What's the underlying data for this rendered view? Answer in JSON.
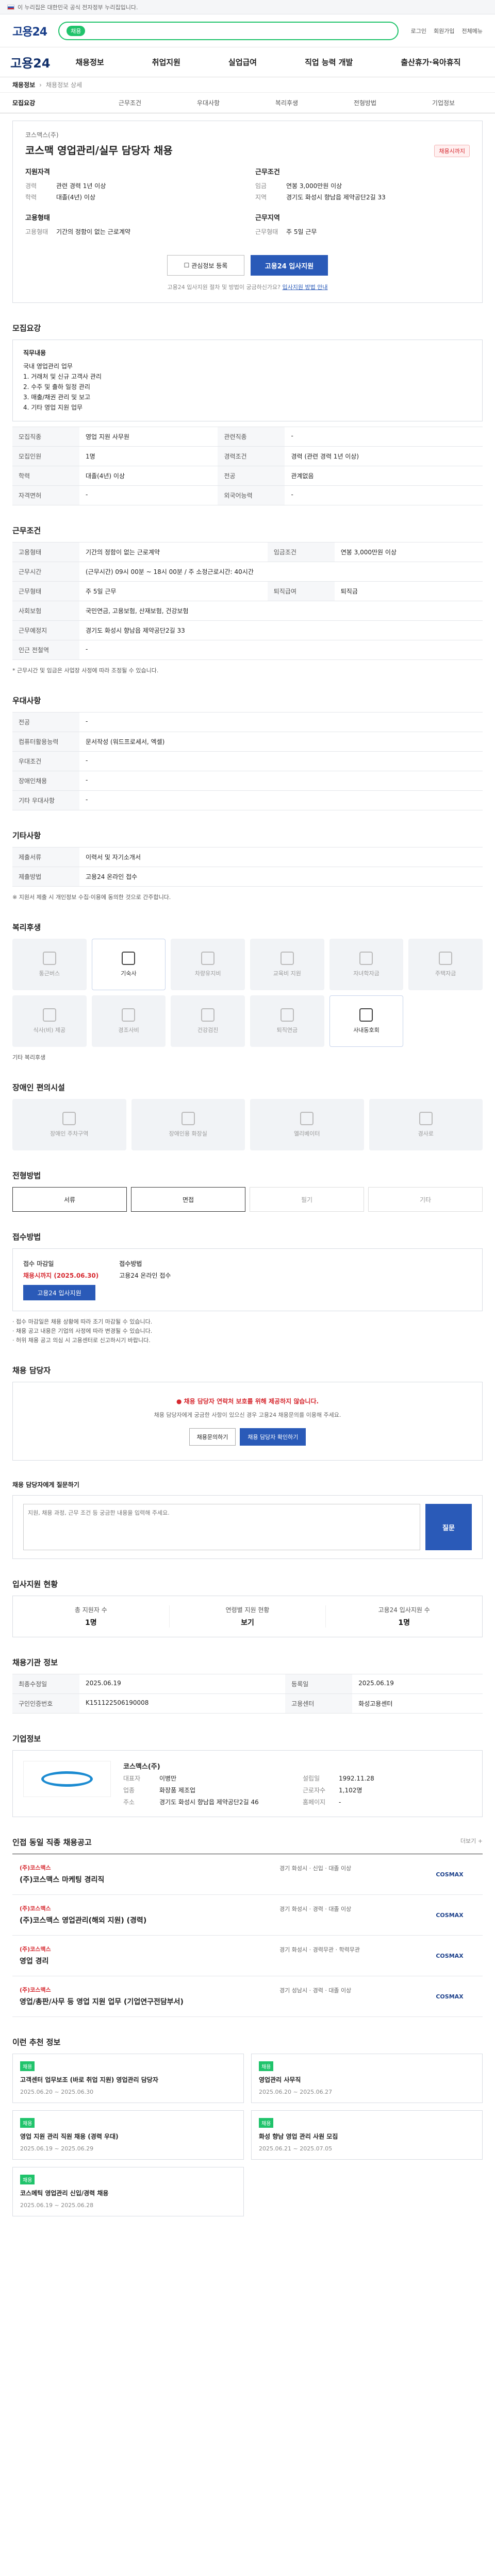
{
  "gov_notice": "이 누리집은 대한민국 공식 전자정부 누리집입니다.",
  "site": {
    "brand": "고용24",
    "search_tag": "채용",
    "header_links": [
      "로그인",
      "회원가입",
      "전체메뉴"
    ],
    "gnb": [
      "채용정보",
      "취업지원",
      "실업급여",
      "직업 능력 개발",
      "출산휴가·육아휴직"
    ]
  },
  "breadcrumb": {
    "current": "채용정보",
    "path": "채용정보 상세"
  },
  "tabs": [
    "모집요강",
    "근무조건",
    "우대사항",
    "복리후생",
    "전형방법",
    "기업정보"
  ],
  "job": {
    "company": "코스맥스(주)",
    "title": "코스맥 영업관리/실무 담당자 채용",
    "deadline_badge": "채용시까지",
    "summary_headings": {
      "recruit": "지원자격",
      "work": "근무조건",
      "cond": "고용형태",
      "place": "근무지역"
    },
    "summary": [
      {
        "k": "경력",
        "v": "관련 경력 1년 이상"
      },
      {
        "k": "학력",
        "v": "대졸(4년) 이상"
      },
      {
        "k": "임금",
        "v": "연봉 3,000만원 이상"
      },
      {
        "k": "지역",
        "v": "경기도 화성시 향남읍 제약공단2길 33"
      },
      {
        "k": "고용형태",
        "v": "기간의 정함이 없는 근로계약"
      },
      {
        "k": "근무형태",
        "v": "주 5일 근무"
      }
    ],
    "scrap_label": "관심정보 등록",
    "apply_label": "고용24 입사지원",
    "notice": "고용24 입사지원 절차 및 방법이 궁금하신가요?",
    "notice_link": "입사지원 방법 안내"
  },
  "recruit": {
    "heading": "모집요강",
    "duty_title": "직무내용",
    "duty_lines": [
      "국내 영업관리 업무",
      "1. 거래처 및 신규 고객사 관리",
      "2. 수주 및 출하 일정 관리",
      "3. 매출/채권 관리 및 보고",
      "4. 기타 영업 지원 업무"
    ],
    "rows": [
      {
        "k": "모집직종",
        "v": "영업 지원 사무원"
      },
      {
        "k": "관련직종",
        "v": "-"
      },
      {
        "k": "모집인원",
        "v": "1명"
      },
      {
        "k": "경력조건",
        "v": "경력 (관련 경력 1년 이상)"
      },
      {
        "k": "학력",
        "v": "대졸(4년) 이상"
      },
      {
        "k": "전공",
        "v": "관계없음"
      },
      {
        "k": "자격면허",
        "v": "-"
      },
      {
        "k": "외국어능력",
        "v": "-"
      }
    ]
  },
  "work": {
    "heading": "근무조건",
    "rows": [
      {
        "k": "고용형태",
        "v": "기간의 정함이 없는 근로계약"
      },
      {
        "k": "임금조건",
        "v": "연봉 3,000만원 이상"
      },
      {
        "k": "근무시간",
        "v": "(근무시간) 09시 00분 ~ 18시 00분 / 주 소정근로시간: 40시간"
      },
      {
        "k": "근무형태",
        "v": "주 5일 근무"
      },
      {
        "k": "사회보험",
        "v": "국민연금, 고용보험, 산재보험, 건강보험"
      },
      {
        "k": "퇴직급여",
        "v": "퇴직금"
      },
      {
        "k": "근무예정지",
        "v": "경기도 화성시 향남읍 제약공단2길 33"
      },
      {
        "k": "인근 전철역",
        "v": "-"
      }
    ],
    "foot": "* 근무시간 및 임금은 사업장 사정에 따라 조정될 수 있습니다."
  },
  "preference": {
    "heading": "우대사항",
    "rows": [
      {
        "k": "전공",
        "v": "-"
      },
      {
        "k": "컴퓨터활용능력",
        "v": "문서작성 (워드프로세서, 엑셀)"
      },
      {
        "k": "우대조건",
        "v": "-"
      },
      {
        "k": "장애인채용",
        "v": "-"
      },
      {
        "k": "기타 우대사항",
        "v": "-"
      }
    ]
  },
  "extra": {
    "heading": "기타사항",
    "rows": [
      {
        "k": "제출서류",
        "v": "이력서 및 자기소개서"
      },
      {
        "k": "제출방법",
        "v": "고용24 온라인 접수"
      }
    ],
    "note": "※ 지원서 제출 시 개인정보 수집·이용에 동의한 것으로 간주합니다."
  },
  "welfare": {
    "heading": "복리후생",
    "items": [
      {
        "label": "통근버스",
        "on": false
      },
      {
        "label": "기숙사",
        "on": true
      },
      {
        "label": "차량유지비",
        "on": false
      },
      {
        "label": "교육비 지원",
        "on": false
      },
      {
        "label": "자녀학자금",
        "on": false
      },
      {
        "label": "주택자금",
        "on": false
      },
      {
        "label": "식사(비) 제공",
        "on": false
      },
      {
        "label": "경조사비",
        "on": false
      },
      {
        "label": "건강검진",
        "on": false
      },
      {
        "label": "퇴직연금",
        "on": false
      },
      {
        "label": "사내동호회",
        "on": true
      }
    ],
    "other_label": "기타 복리후생"
  },
  "disabled": {
    "heading": "장애인 편의시설",
    "items": [
      "장애인 주차구역",
      "장애인용 화장실",
      "엘리베이터",
      "경사로"
    ]
  },
  "process": {
    "heading": "전형방법",
    "steps": [
      {
        "label": "서류",
        "on": true
      },
      {
        "label": "면접",
        "on": true
      },
      {
        "label": "필기",
        "on": false
      },
      {
        "label": "기타",
        "on": false
      }
    ]
  },
  "howto": {
    "heading": "접수방법",
    "deadline_title": "접수 마감일",
    "deadline": "채용시까지 (2025.06.30)",
    "method_title": "접수방법",
    "method": "고용24 온라인 접수",
    "apply_label": "고용24 입사지원",
    "bullets": [
      "· 접수 마감일은 채용 상황에 따라 조기 마감될 수 있습니다.",
      "· 채용 공고 내용은 기업의 사정에 따라 변경될 수 있습니다.",
      "· 허위 채용 공고 의심 시 고용센터로 신고하시기 바랍니다."
    ]
  },
  "contact": {
    "heading": "채용 담당자",
    "warn": "채용 담당자 연락처 보호를 위해 제공하지 않습니다.",
    "desc": "채용 담당자에게 궁금한 사항이 있으신 경우 고용24 채용문의를 이용해 주세요.",
    "btn1": "채용문의하기",
    "btn2": "채용 담당자 확인하기"
  },
  "inquiry": {
    "heading": "채용 담당자에게 질문하기",
    "placeholder": "지원, 채용 과정, 근무 조건 등 궁금한 내용을 입력해 주세요.",
    "send": "질문"
  },
  "stats": {
    "heading": "입사지원 현황",
    "items": [
      {
        "label": "총 지원자 수",
        "value": "1명"
      },
      {
        "label": "연령별 지원 현황",
        "value": "보기"
      },
      {
        "label": "고용24 입사지원 수",
        "value": "1명"
      }
    ]
  },
  "regi": {
    "heading": "채용기관 정보",
    "rows": [
      {
        "k": "최종수정일",
        "v": "2025.06.19"
      },
      {
        "k": "등록일",
        "v": "2025.06.19"
      },
      {
        "k": "구인인증번호",
        "v": "K151122506190008"
      },
      {
        "k": "고용센터",
        "v": "화성고용센터"
      }
    ]
  },
  "company": {
    "heading": "기업정보",
    "name": "코스맥스(주)",
    "rows": [
      {
        "k": "대표자",
        "v": "이병만"
      },
      {
        "k": "설립일",
        "v": "1992.11.28"
      },
      {
        "k": "업종",
        "v": "화장품 제조업"
      },
      {
        "k": "근로자수",
        "v": "1,102명"
      },
      {
        "k": "주소",
        "v": "경기도 화성시 향남읍 제약공단2길 46"
      },
      {
        "k": "홈페이지",
        "v": "-"
      }
    ]
  },
  "related": {
    "heading": "인접 동일 직종 채용공고",
    "more": "더보기 +",
    "items": [
      {
        "company": "(주)코스맥스",
        "title": "(주)코스맥스 마케팅 경리직",
        "meta": "경기 화성시 · 신입 · 대졸 이상",
        "logo": "COSMAX"
      },
      {
        "company": "(주)코스맥스",
        "title": "(주)코스맥스 영업관리(해외 지원) (경력)",
        "meta": "경기 화성시 · 경력 · 대졸 이상",
        "logo": "COSMAX"
      },
      {
        "company": "(주)코스맥스",
        "title": "영업 경리",
        "meta": "경기 화성시 · 경력무관 · 학력무관",
        "logo": "COSMAX"
      },
      {
        "company": "(주)코스맥스",
        "title": "영업/총판/사무 등 영업 지원 업무 (기업연구전담부서)",
        "meta": "경기 성남시 · 경력 · 대졸 이상",
        "logo": "COSMAX"
      }
    ]
  },
  "recommend": {
    "heading": "이런 추천 정보",
    "items": [
      {
        "tag": "채용",
        "title": "고객센터 업무보조 (바로 취업 지원) 영업관리 담당자",
        "date": "2025.06.20 ~ 2025.06.30"
      },
      {
        "tag": "채용",
        "title": "영업관리 사무직",
        "date": "2025.06.20 ~ 2025.06.27"
      },
      {
        "tag": "채용",
        "title": "영업 지원 관리 직원 채용 (경력 우대)",
        "date": "2025.06.19 ~ 2025.06.29"
      },
      {
        "tag": "채용",
        "title": "화성 향남 영업 관리 사원 모집",
        "date": "2025.06.21 ~ 2025.07.05"
      },
      {
        "tag": "채용",
        "title": "코스메틱 영업관리 신입/경력 채용",
        "date": "2025.06.19 ~ 2025.06.28"
      }
    ]
  }
}
